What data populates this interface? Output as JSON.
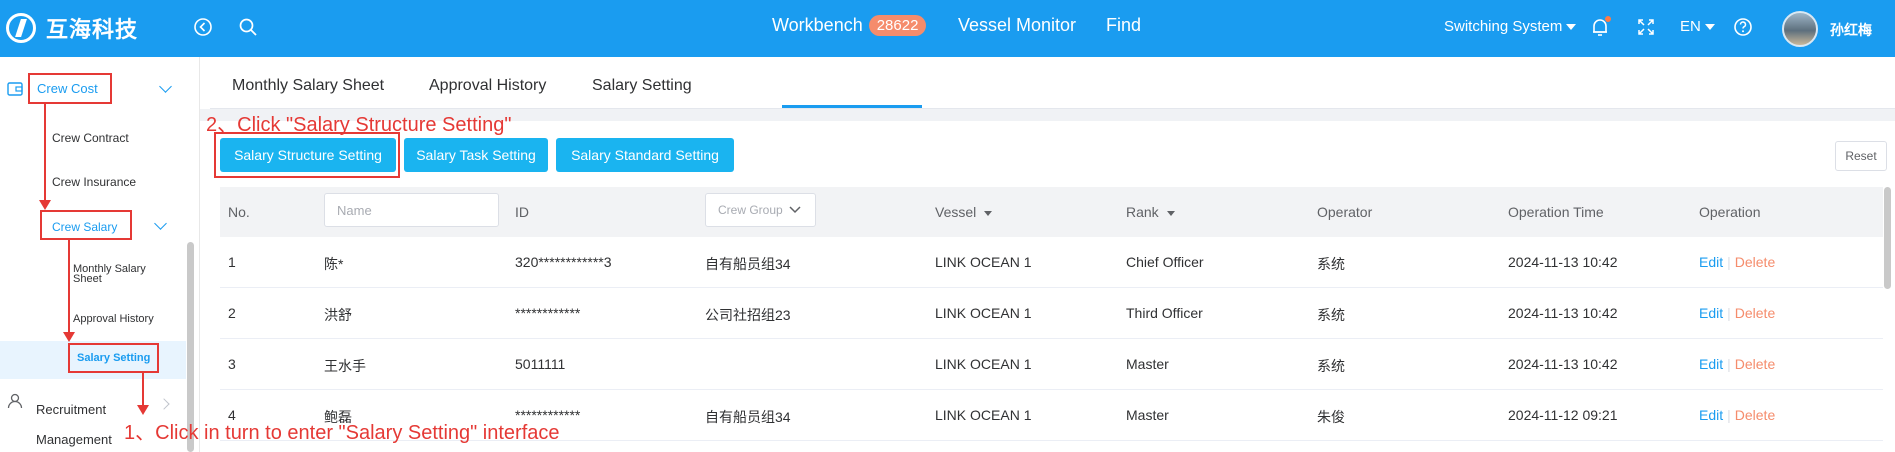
{
  "topbar": {
    "brand": "互海科技",
    "nav": {
      "workbench": "Workbench",
      "workbench_badge": "28622",
      "vessel_monitor": "Vessel Monitor",
      "find": "Find"
    },
    "switching_system": "Switching System",
    "language": "EN",
    "user_name": "孙红梅"
  },
  "sidebar": {
    "crew_cost": "Crew Cost",
    "crew_contract": "Crew Contract",
    "crew_insurance": "Crew Insurance",
    "crew_salary": "Crew Salary",
    "monthly_salary_sheet_1": "Monthly Salary",
    "monthly_salary_sheet_2": "Sheet",
    "approval_history": "Approval History",
    "salary_setting": "Salary Setting",
    "recruitment_1": "Recruitment",
    "recruitment_2": "Management"
  },
  "tabs": [
    "Monthly Salary Sheet",
    "Approval History",
    "Salary Setting"
  ],
  "buttons": {
    "structure": "Salary Structure Setting",
    "task": "Salary Task Setting",
    "standard": "Salary Standard Setting",
    "reset": "Reset"
  },
  "table": {
    "headers": {
      "no": "No.",
      "name_placeholder": "Name",
      "id": "ID",
      "crew_group": "Crew Group",
      "vessel": "Vessel",
      "rank": "Rank",
      "operator": "Operator",
      "operation_time": "Operation Time",
      "operation": "Operation"
    },
    "edit": "Edit",
    "sep": "|",
    "delete": "Delete",
    "rows": [
      {
        "no": "1",
        "name": "陈*",
        "id": "320************3",
        "group": "自有船员组34",
        "vessel": "LINK OCEAN 1",
        "rank": "Chief Officer",
        "operator": "系统",
        "time": "2024-11-13 10:42"
      },
      {
        "no": "2",
        "name": "洪舒",
        "id": "************",
        "group": "公司社招组23",
        "vessel": "LINK OCEAN 1",
        "rank": "Third Officer",
        "operator": "系统",
        "time": "2024-11-13 10:42"
      },
      {
        "no": "3",
        "name": "王水手",
        "id": "5011111",
        "group": "",
        "vessel": "LINK OCEAN 1",
        "rank": "Master",
        "operator": "系统",
        "time": "2024-11-13 10:42"
      },
      {
        "no": "4",
        "name": "鲍磊",
        "id": "************",
        "group": "自有船员组34",
        "vessel": "LINK OCEAN 1",
        "rank": "Master",
        "operator": "朱俊",
        "time": "2024-11-12 09:21"
      }
    ]
  },
  "annotations": {
    "step2": "2、Click \"Salary Structure Setting\"",
    "step1": "1、Click in turn to enter \"Salary Setting\" interface"
  }
}
